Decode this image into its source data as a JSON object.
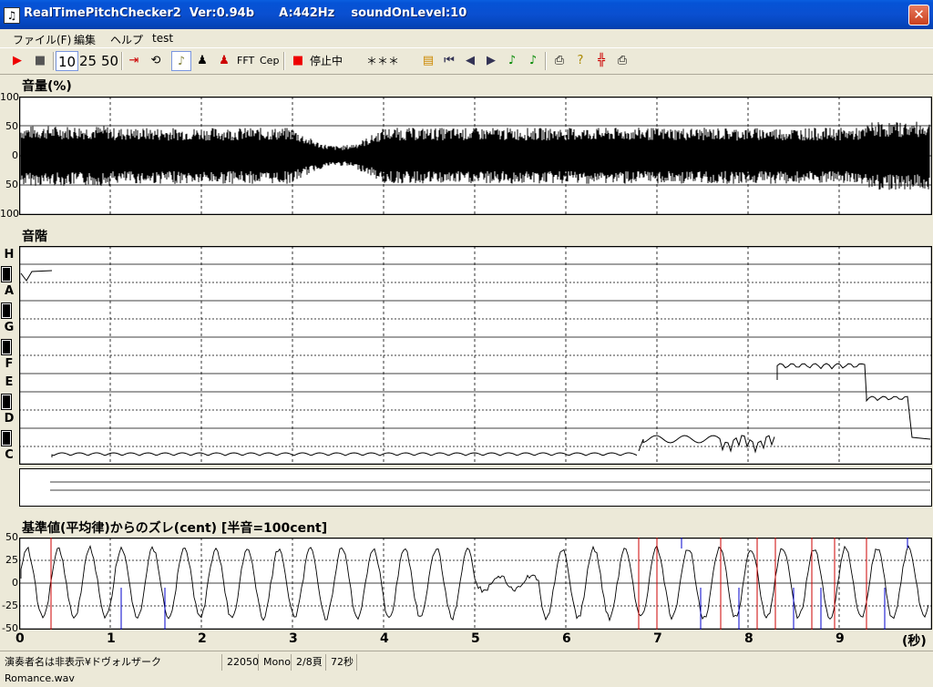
{
  "window": {
    "title": "RealTimePitchChecker2  Ver:0.94b      A:442Hz    soundOnLevel:10"
  },
  "menu": [
    "ファイル(F)",
    "編集",
    "ヘルプ",
    "test"
  ],
  "toolbar": {
    "num10": "10",
    "num25": "25",
    "num50": "50",
    "fft": "FFT",
    "cep": "Cep",
    "status": "停止中",
    "display": "＊＊＊"
  },
  "volume": {
    "label": "音量(%)",
    "ticks": [
      "100",
      "50",
      "0",
      "50",
      "100"
    ]
  },
  "scale": {
    "label": "音階",
    "notes": [
      "H",
      "A",
      "G",
      "F",
      "E",
      "D",
      "C"
    ]
  },
  "deviation": {
    "label": "基準値(平均律)からのズレ(cent) [半音=100cent]",
    "ticks": [
      "50",
      "25",
      "0",
      "-25",
      "-50"
    ]
  },
  "xaxis": {
    "ticks": [
      "0",
      "1",
      "2",
      "3",
      "4",
      "5",
      "6",
      "7",
      "8",
      "9"
    ],
    "unit": "(秒)"
  },
  "statusbar": {
    "file": "演奏者名は非表示¥ドヴォルザークRomance.wav",
    "rate": "22050",
    "channels": "Mono",
    "page": "2/8頁",
    "duration": "72秒"
  },
  "colors": {
    "titlebar": "#0a4fd0",
    "waveform": "#000000",
    "red_marker": "#cc0000",
    "blue_marker": "#0000cc"
  }
}
